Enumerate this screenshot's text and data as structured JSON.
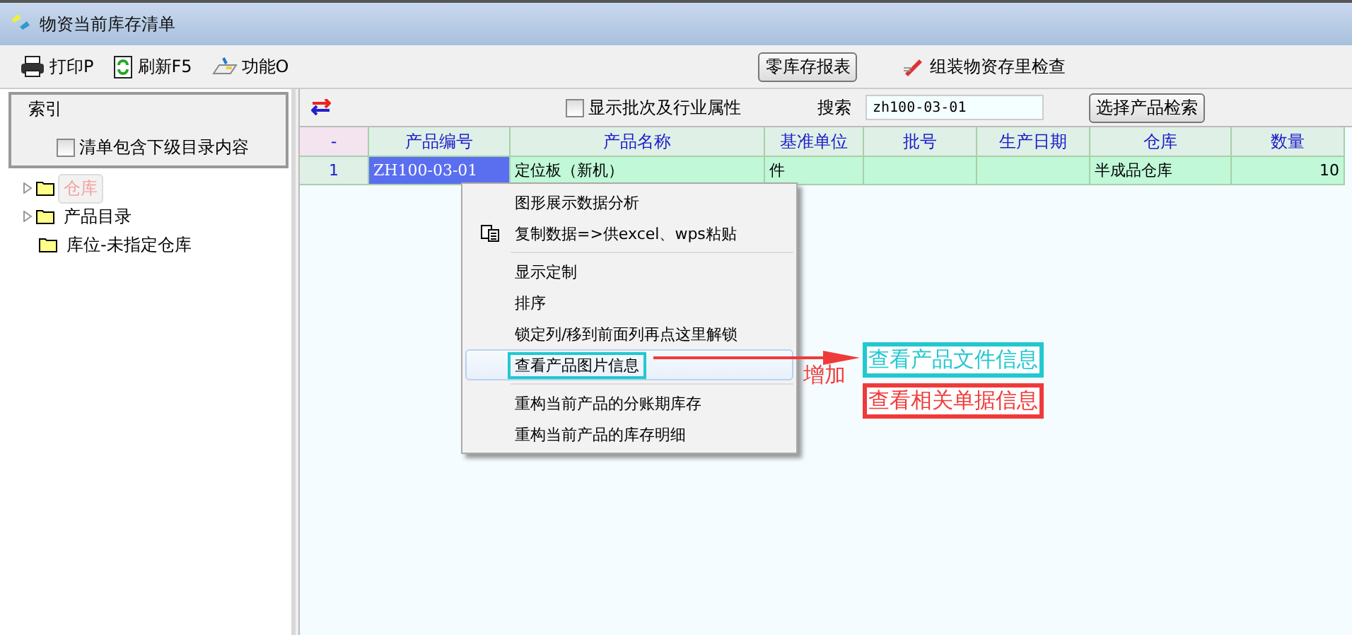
{
  "window": {
    "title": "物资当前库存清单"
  },
  "toolbar": {
    "buttons": [
      {
        "kind": "print",
        "label": "打印P"
      },
      {
        "kind": "refresh",
        "label": "刷新F5"
      },
      {
        "kind": "function",
        "label": "功能O"
      }
    ],
    "report_button": "零库存报表",
    "check_button": "组装物资存里检查"
  },
  "index_panel": {
    "title": "索引",
    "include_sub": {
      "label": "清单包含下级目录内容",
      "checked": false
    }
  },
  "tree": [
    {
      "label": "仓库",
      "selected": true,
      "expanded": false
    },
    {
      "label": "产品目录",
      "selected": false,
      "expanded": false
    },
    {
      "label": "库位-未指定仓库",
      "selected": false
    }
  ],
  "grid_toolbar": {
    "show_batch": {
      "label": "显示批次及行业属性",
      "checked": false
    },
    "search_label": "搜索",
    "search_value": "zh100-03-01",
    "select_button": "选择产品检索"
  },
  "table": {
    "columns": [
      "-",
      "产品编号",
      "产品名称",
      "基准单位",
      "批号",
      "生产日期",
      "仓库",
      "数量"
    ],
    "rows": [
      {
        "cells": [
          "1",
          "ZH100-03-01",
          "定位板（新机）",
          "件",
          "",
          "",
          "半成品仓库",
          "10"
        ],
        "selected": true
      }
    ]
  },
  "context_menu": [
    {
      "kind": "item",
      "label": "图形展示数据分析",
      "icon": false,
      "highlighted": false
    },
    {
      "kind": "item",
      "label": "复制数据=>供excel、wps粘贴",
      "icon": true,
      "highlighted": false
    },
    {
      "kind": "separator"
    },
    {
      "kind": "item",
      "label": "显示定制",
      "icon": false,
      "highlighted": false
    },
    {
      "kind": "item",
      "label": "排序",
      "icon": false,
      "highlighted": false
    },
    {
      "kind": "item",
      "label": "锁定列/移到前面列再点这里解锁",
      "icon": false,
      "highlighted": false
    },
    {
      "kind": "item",
      "label": "查看产品图片信息",
      "icon": false,
      "highlighted": true,
      "boxed": true
    },
    {
      "kind": "separator"
    },
    {
      "kind": "item",
      "label": "重构当前产品的分账期库存",
      "icon": false,
      "highlighted": false
    },
    {
      "kind": "item",
      "label": "重构当前产品的库存明细",
      "icon": false,
      "highlighted": false
    }
  ],
  "annotation": {
    "arrow_label": "增加",
    "added": [
      {
        "label": "查看产品文件信息",
        "color": "#22c8d0"
      },
      {
        "label": "查看相关单据信息",
        "color": "#f03a3a"
      }
    ]
  }
}
